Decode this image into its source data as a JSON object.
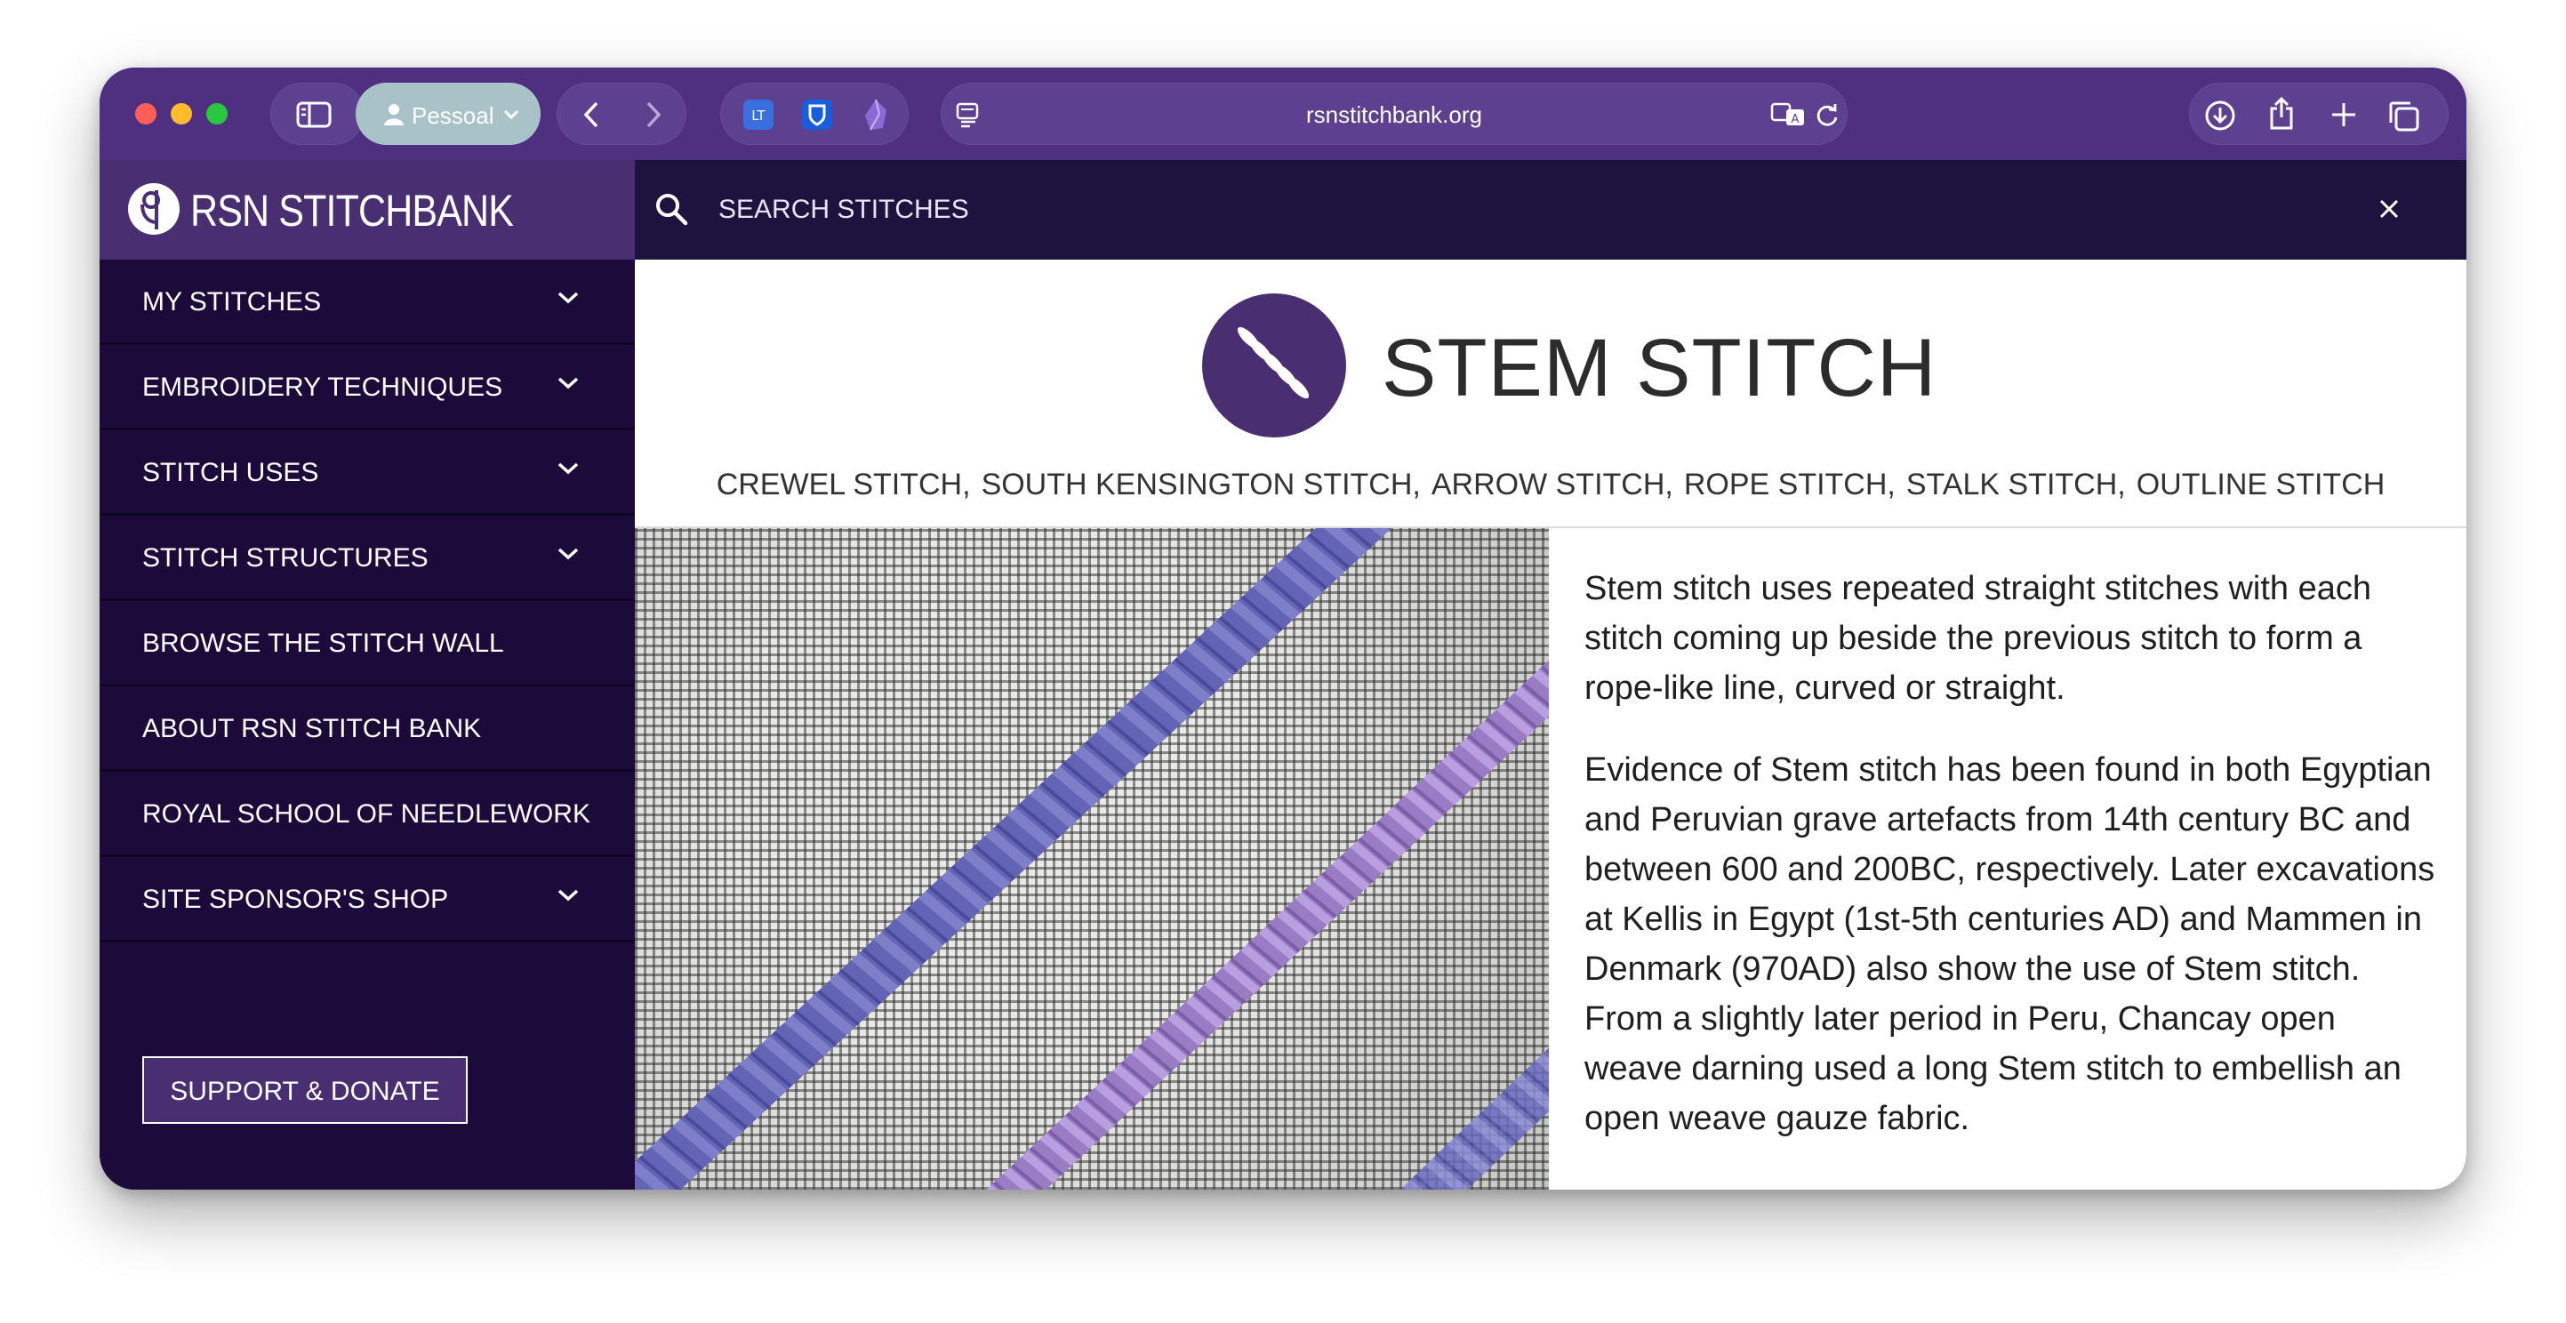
{
  "browser": {
    "profile_label": "Pessoal",
    "url": "rsnstitchbank.org"
  },
  "site": {
    "logo_text": "RSN STITCHBANK"
  },
  "nav": {
    "items": [
      {
        "label": "MY STITCHES",
        "has_chevron": true
      },
      {
        "label": "EMBROIDERY TECHNIQUES",
        "has_chevron": true
      },
      {
        "label": "STITCH USES",
        "has_chevron": true
      },
      {
        "label": "STITCH STRUCTURES",
        "has_chevron": true
      },
      {
        "label": "BROWSE THE STITCH WALL",
        "has_chevron": false
      },
      {
        "label": "ABOUT RSN STITCH BANK",
        "has_chevron": false
      },
      {
        "label": "ROYAL SCHOOL OF NEEDLEWORK",
        "has_chevron": false
      },
      {
        "label": "SITE SPONSOR'S SHOP",
        "has_chevron": true
      }
    ],
    "donate_label": "SUPPORT & DONATE"
  },
  "search": {
    "placeholder": "SEARCH STITCHES"
  },
  "stitch": {
    "title": "STEM STITCH",
    "aka": [
      "CREWEL STITCH,",
      "SOUTH KENSINGTON STITCH,",
      "ARROW STITCH,",
      "ROPE STITCH,",
      "STALK STITCH,",
      "OUTLINE STITCH"
    ],
    "description": [
      "Stem stitch uses repeated straight stitches with each stitch coming up beside the previous stitch to form a rope-like line, curved or straight.",
      "Evidence of Stem stitch has been found in both Egyptian and Peruvian grave artefacts from 14th century BC and between 600 and 200BC, respectively.  Later excavations at Kellis in Egypt (1st-5th centuries AD) and Mammen in Denmark (970AD) also show the use of Stem stitch.  From a slightly later period in Peru, Chancay open weave darning used a long Stem stitch to embellish an open weave gauze fabric."
    ]
  },
  "colors": {
    "brand_purple": "#4a2e72",
    "sidebar_bg": "#1c0b3a",
    "search_bg": "#1d133f",
    "thread_blue": "#6b6bc0",
    "thread_lilac": "#9a7cc4"
  }
}
